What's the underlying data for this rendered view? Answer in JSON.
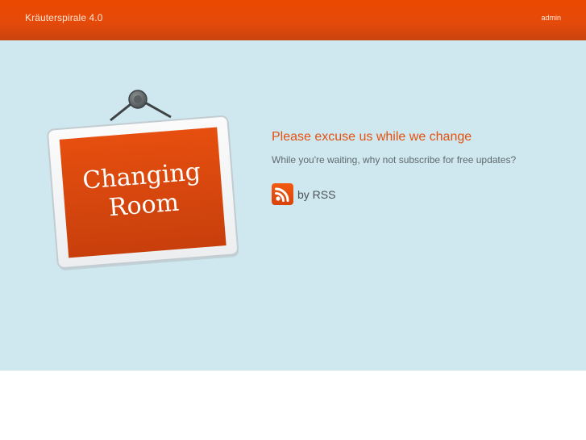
{
  "header": {
    "site_title": "Kräuterspirale 4.0",
    "admin_label": "admin"
  },
  "sign": {
    "line1": "Changing",
    "line2": "Room"
  },
  "main": {
    "heading": "Please excuse us while we change",
    "subtitle": "While you're waiting, why not subscribe for free updates?",
    "rss_label": "by RSS"
  },
  "colors": {
    "header_bg": "#e64a0a",
    "band_bg": "#cfe8ef",
    "accent": "#e5500e",
    "sign_red": "#d9470c"
  },
  "icons": {
    "feed": "rss-icon"
  }
}
